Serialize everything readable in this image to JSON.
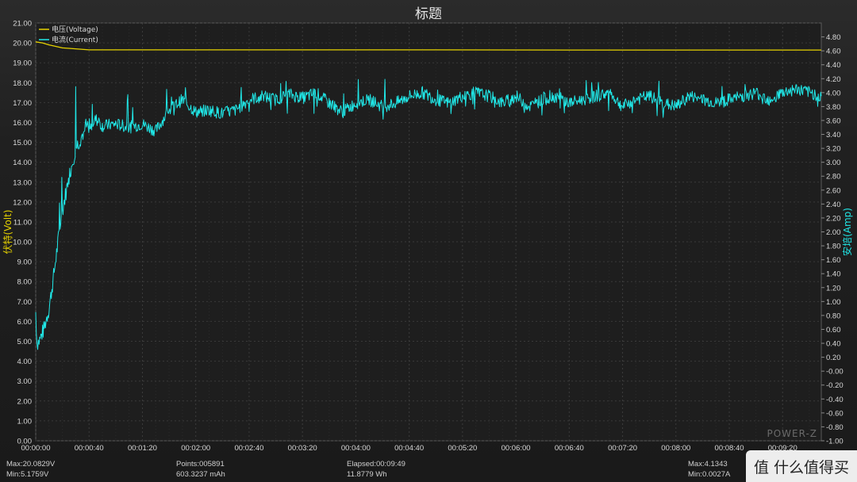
{
  "chart_data": {
    "type": "line",
    "title": "标题",
    "xlabel": "",
    "ylabel": "伏特(Volt)",
    "y2label": "安培(Amp)",
    "xlim_seconds": [
      0,
      589
    ],
    "ylim": [
      0,
      21
    ],
    "y2lim": [
      -1.0,
      5.0
    ],
    "x_ticks": [
      "00:00:00",
      "00:00:40",
      "00:01:20",
      "00:02:00",
      "00:02:40",
      "00:03:20",
      "00:04:00",
      "00:04:40",
      "00:05:20",
      "00:06:00",
      "00:06:40",
      "00:07:20",
      "00:08:00",
      "00:08:40",
      "00:09:20"
    ],
    "y_ticks": [
      "0.00",
      "1.00",
      "2.00",
      "3.00",
      "4.00",
      "5.00",
      "6.00",
      "7.00",
      "8.00",
      "9.00",
      "10.00",
      "11.00",
      "12.00",
      "13.00",
      "14.00",
      "15.00",
      "16.00",
      "17.00",
      "18.00",
      "19.00",
      "20.00",
      "21.00"
    ],
    "y2_ticks": [
      "-1.00",
      "-0.80",
      "-0.60",
      "-0.40",
      "-0.20",
      "-0.00",
      "0.20",
      "0.40",
      "0.60",
      "0.80",
      "1.00",
      "1.20",
      "1.40",
      "1.60",
      "1.80",
      "2.00",
      "2.20",
      "2.40",
      "2.60",
      "2.80",
      "3.00",
      "3.20",
      "3.40",
      "3.60",
      "3.80",
      "4.00",
      "4.20",
      "4.40",
      "4.60",
      "4.80"
    ],
    "grid": true,
    "legend_position": "top-left",
    "series": [
      {
        "name": "电压(Voltage)",
        "color": "#e6d200",
        "axis": "left",
        "x": [
          0,
          5,
          10,
          20,
          30,
          40,
          50,
          60,
          100,
          200,
          300,
          400,
          500,
          589
        ],
        "values": [
          20.05,
          20.0,
          19.9,
          19.75,
          19.7,
          19.65,
          19.65,
          19.65,
          19.65,
          19.65,
          19.65,
          19.64,
          19.64,
          19.64
        ]
      },
      {
        "name": "电流(Current)",
        "color": "#20e8e8",
        "axis": "right",
        "x": [
          0,
          1,
          3,
          6,
          10,
          13,
          17,
          20,
          25,
          30,
          35,
          38,
          42,
          45,
          50,
          60,
          70,
          80,
          90,
          100,
          110,
          120,
          130,
          140,
          150,
          160,
          170,
          180,
          190,
          200,
          210,
          220,
          230,
          240,
          250,
          260,
          270,
          280,
          290,
          300,
          310,
          320,
          330,
          340,
          350,
          360,
          370,
          380,
          390,
          400,
          410,
          420,
          430,
          440,
          450,
          460,
          470,
          480,
          490,
          500,
          510,
          520,
          530,
          540,
          550,
          560,
          570,
          580,
          589
        ],
        "values": [
          0.85,
          0.4,
          0.45,
          0.6,
          0.9,
          1.3,
          1.9,
          2.3,
          2.8,
          3.2,
          3.4,
          3.52,
          3.55,
          3.62,
          3.52,
          3.55,
          3.5,
          3.55,
          3.45,
          3.75,
          3.9,
          3.72,
          3.75,
          3.7,
          3.75,
          3.9,
          3.95,
          3.9,
          3.98,
          3.92,
          4.0,
          3.85,
          3.72,
          3.85,
          3.9,
          3.8,
          3.85,
          3.95,
          4.0,
          3.9,
          3.85,
          3.95,
          4.0,
          3.95,
          3.85,
          3.95,
          3.8,
          3.9,
          3.95,
          3.85,
          3.9,
          3.95,
          4.0,
          3.8,
          3.9,
          3.95,
          3.85,
          3.8,
          3.95,
          3.9,
          3.85,
          3.9,
          3.95,
          4.0,
          3.9,
          4.0,
          4.05,
          4.0,
          3.95
        ]
      }
    ]
  },
  "stats": {
    "max_voltage": "Max:20.0829V",
    "min_voltage": "Min:5.1759V",
    "points": "Points:005891",
    "capacity": "603.3237 mAh",
    "elapsed": "Elapsed:00:09:49",
    "energy": "11.8779 Wh",
    "max_current": "Max:4.1343",
    "min_current": "Min:0.0027A"
  },
  "watermark": {
    "text": "值 什么值得买",
    "brand_text": "POWER-Z"
  }
}
